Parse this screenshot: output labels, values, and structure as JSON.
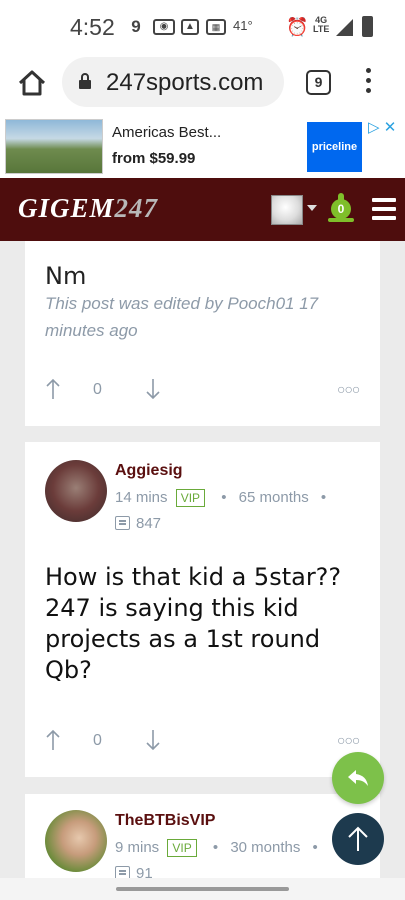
{
  "status_bar": {
    "time": "4:52",
    "temperature": "41°",
    "network": "4G LTE"
  },
  "browser": {
    "url": "247sports.com",
    "tab_count": "9"
  },
  "ad": {
    "title": "Americas Best...",
    "price": "from $59.99",
    "brand": "priceline"
  },
  "site": {
    "logo_text": "GIGEM",
    "logo_number": "247",
    "notifications": "0"
  },
  "posts": [
    {
      "body": "Nm",
      "edit_note": "This post was edited by Pooch01 17 minutes ago",
      "votes": "0"
    },
    {
      "author": "Aggiesig",
      "time": "14 mins",
      "badge": "VIP",
      "tenure": "65 months",
      "replies": "847",
      "body": "How is that kid a 5star?? 247 is saying this kid projects as a 1st round Qb?",
      "votes": "0"
    },
    {
      "author": "TheBTBisVIP",
      "time": "9 mins",
      "badge": "VIP",
      "tenure": "30 months",
      "replies": "91"
    }
  ]
}
